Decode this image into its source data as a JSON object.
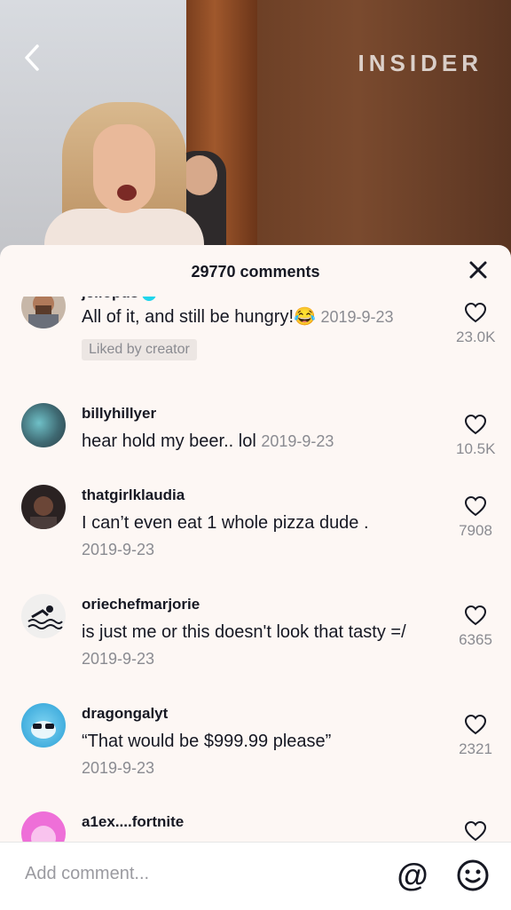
{
  "video": {
    "brand": "INSIDER"
  },
  "comments_header": {
    "count_label": "29770 comments"
  },
  "comments": [
    {
      "username": "jellopus",
      "text": "All of it, and still be hungry!😂",
      "date": "2019-9-23",
      "likes": "23.0K",
      "badge": "Liked by creator",
      "avatar_icon": "man-avatar"
    },
    {
      "username": "billyhillyer",
      "text": "hear hold my beer.. lol",
      "date": "2019-9-23",
      "likes": "10.5K",
      "avatar_icon": "swirl-avatar"
    },
    {
      "username": "thatgirlklaudia",
      "text": "I can’t even eat 1 whole pizza dude .",
      "date": "2019-9-23",
      "likes": "7908",
      "avatar_icon": "girl-avatar"
    },
    {
      "username": "oriechefmarjorie",
      "text": "is just me or this doesn't look that tasty =/",
      "date": "2019-9-23",
      "likes": "6365",
      "avatar_icon": "swimmer-avatar"
    },
    {
      "username": "dragongalyt",
      "text": "“That would be $999.99 please”",
      "date": "2019-9-23",
      "likes": "2321",
      "avatar_icon": "cartoon-avatar"
    },
    {
      "username": "a1ex....fortnite",
      "text": "",
      "date": "",
      "likes": "",
      "avatar_icon": "pink-avatar"
    }
  ],
  "composer": {
    "placeholder": "Add comment..."
  },
  "colors": {
    "accent_verified": "#20d5ec",
    "text_primary": "#161823",
    "text_secondary": "#8a8b91",
    "sheet_bg": "#fdf7f4"
  }
}
